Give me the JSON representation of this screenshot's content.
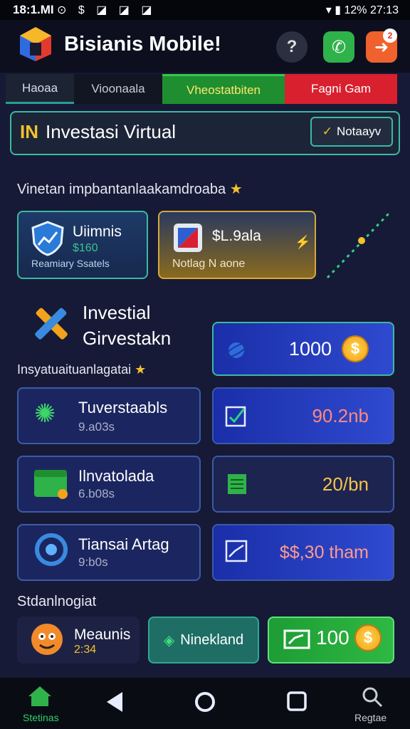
{
  "status_bar": {
    "time": "18:1.MI",
    "left_icons": "⊙ $ ◪ ◪ ◪",
    "battery": "12%",
    "clock_right": "27:13"
  },
  "header": {
    "title": "Bisianis Mobile!",
    "notification_count": "2"
  },
  "tabs": [
    {
      "label": "Haoaa"
    },
    {
      "label": "Vioonaala"
    },
    {
      "label": "Vheostatbiten"
    },
    {
      "label": "Fagni Gam"
    }
  ],
  "invest_bar": {
    "mark": "IN",
    "title": "Investasi Virtual",
    "button_label": "Notaayv"
  },
  "section1": {
    "label": "Vinetan impbantanlaakamdroaba"
  },
  "feature_cards": [
    {
      "title": "Uiimnis",
      "value": "$160",
      "subtitle": "Reamiary Ssatels"
    },
    {
      "title": "$L.9ala",
      "subtitle": "Notlag N aone"
    }
  ],
  "invest_heading": {
    "line1": "Investial",
    "line2": "Girvestakn"
  },
  "balance_card": {
    "value": "1000",
    "coin": "$"
  },
  "section2": {
    "label": "Insyatuaituanlagatai"
  },
  "action_rows": [
    {
      "title": "Tuverstaabls",
      "sub": "9.a03s",
      "value": "90.2nb"
    },
    {
      "title": "Ilnvatolada",
      "sub": "6.b08s",
      "value": "20/bn"
    },
    {
      "title": "Tiansai Artag",
      "sub": "9:b0s",
      "value": "$$,30 tham"
    }
  ],
  "section3": {
    "label": "Stdanlnogiat"
  },
  "bottom_cards": [
    {
      "title": "Meaunis",
      "sub": "2:34"
    },
    {
      "label": "Ninekland"
    },
    {
      "value": "100",
      "coin": "$"
    }
  ],
  "nav": {
    "home_label": "Stetinas",
    "search_label": "Regtae"
  },
  "colors": {
    "background": "#161a36",
    "accent_teal": "#3bb9a2",
    "accent_green": "#1f8e30",
    "accent_red": "#d8202e",
    "gold": "#f2c12e"
  }
}
